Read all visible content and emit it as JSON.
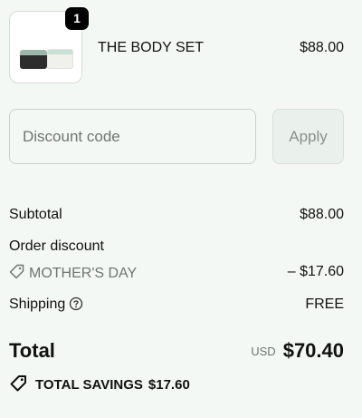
{
  "product": {
    "name": "THE BODY SET",
    "price": "$88.00",
    "quantity": "1"
  },
  "discount": {
    "placeholder": "Discount code",
    "apply_label": "Apply"
  },
  "summary": {
    "subtotal_label": "Subtotal",
    "subtotal_value": "$88.00",
    "order_discount_label": "Order discount",
    "discount_code": "MOTHER'S DAY",
    "discount_value": "– $17.60",
    "shipping_label": "Shipping",
    "shipping_value": "FREE"
  },
  "total": {
    "label": "Total",
    "currency": "USD",
    "amount": "$70.40",
    "savings_label": "TOTAL SAVINGS",
    "savings_amount": "$17.60"
  },
  "icons": {
    "discount_tag": "tag-icon",
    "shipping_help": "help-circle-icon",
    "savings": "tag-icon"
  }
}
